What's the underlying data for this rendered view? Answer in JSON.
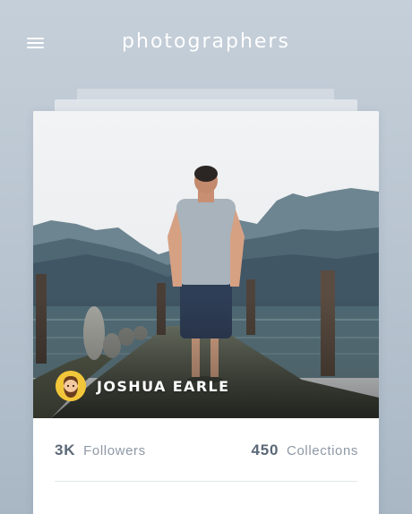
{
  "header": {
    "title": "photographers",
    "menu_icon": "hamburger-menu-icon"
  },
  "card": {
    "author": {
      "name": "JOSHUA EARLE",
      "avatar_icon": "bearded-man-avatar"
    },
    "photo": {
      "subject": "man standing on stone pier facing mountain lake"
    },
    "stats": {
      "followers_count": "3K",
      "followers_label": "Followers",
      "collections_count": "450",
      "collections_label": "Collections"
    }
  },
  "colors": {
    "background_top": "#c5cfd9",
    "background_bottom": "#a9b7c5",
    "avatar_bg": "#f2c63a",
    "stat_number": "#5b6877",
    "stat_label": "#8e99a6"
  }
}
